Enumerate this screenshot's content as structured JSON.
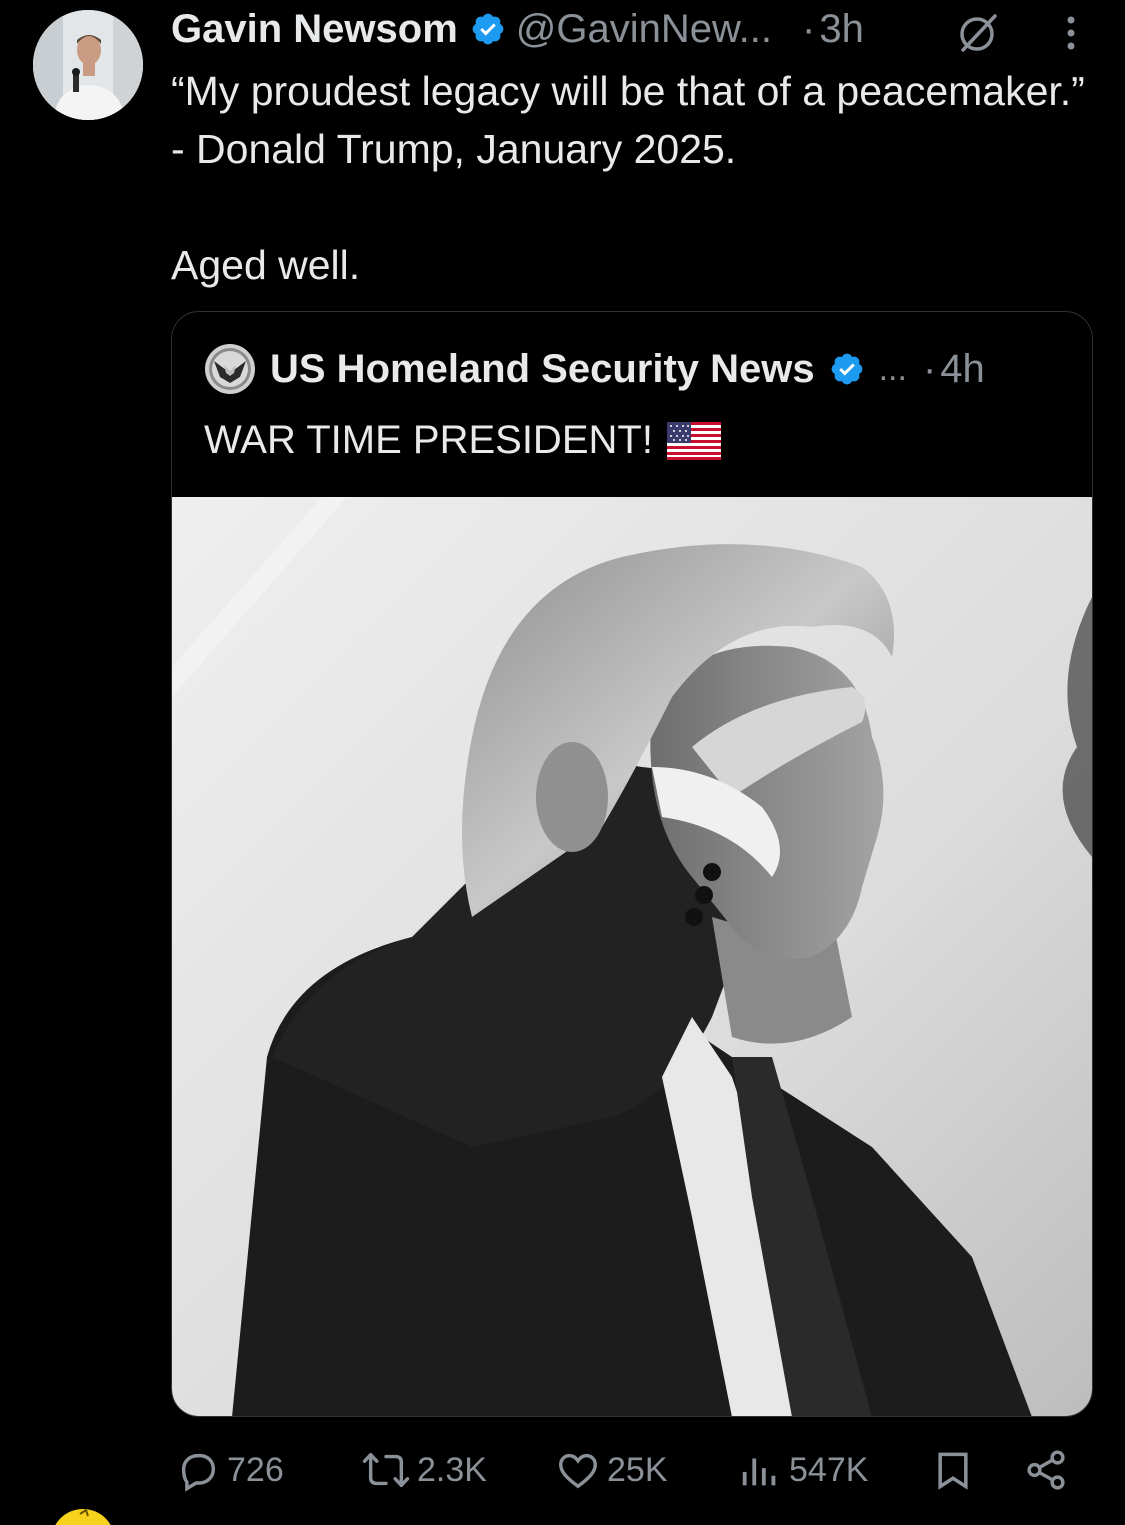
{
  "tweet": {
    "author_name": "Gavin Newsom",
    "handle": "@GavinNew...",
    "separator": "·",
    "time": "3h",
    "text": "“My proudest legacy will be that of a peacemaker.” - Donald Trump, January 2025.\n\nAged well.",
    "verified_icon": "verified-badge-icon",
    "grok_icon": "grok-icon",
    "more_icon": "more-vertical-icon"
  },
  "quote": {
    "author_name": "US Homeland Security News",
    "ellipsis": "...",
    "separator": "·",
    "time": "4h",
    "text": "WAR TIME PRESIDENT!",
    "emoji": "us-flag-icon",
    "photo_icon": "photo-salute"
  },
  "actions": {
    "replies": "726",
    "reposts": "2.3K",
    "likes": "25K",
    "views": "547K"
  },
  "colors": {
    "background": "#000000",
    "text_primary": "#e7e9ea",
    "text_secondary": "#8b9198",
    "verified_blue": "#1d9bf0",
    "border": "#2f3336"
  }
}
